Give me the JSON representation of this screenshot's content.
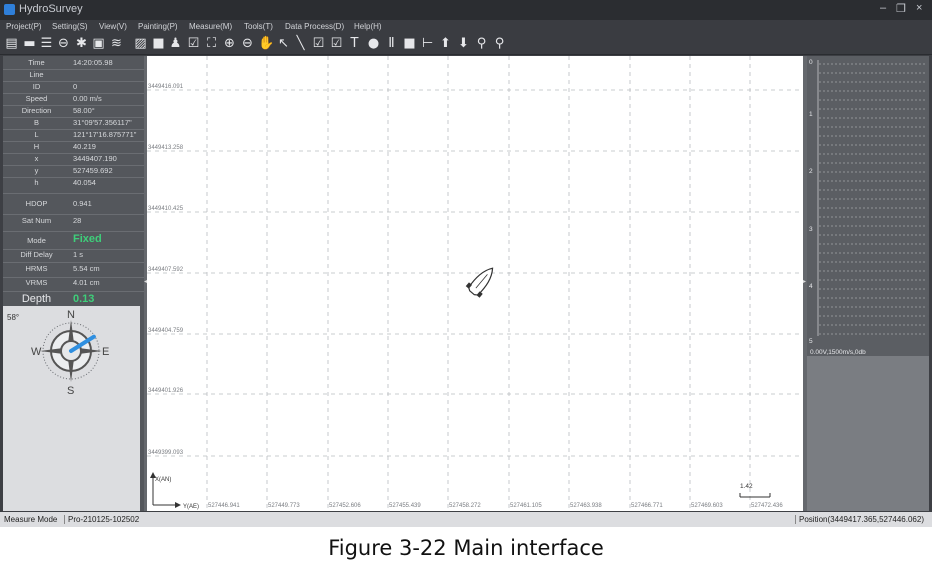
{
  "window": {
    "title": "HydroSurvey"
  },
  "menu": [
    "Project(P)",
    "Setting(S)",
    "View(V)",
    "Painting(P)",
    "Measure(M)",
    "Tools(T)",
    "Data Process(D)",
    "Help(H)"
  ],
  "toolbar_icons": [
    "new-project-icon",
    "open-icon",
    "database-icon",
    "link-icon",
    "settings-icon",
    "image-icon",
    "wave-icon",
    "edit-icon",
    "record-icon",
    "survey-icon",
    "checklist-icon",
    "fullscreen-icon",
    "zoom-in-icon",
    "zoom-out-icon",
    "pan-icon",
    "pointer-icon",
    "line-icon",
    "edit-note-icon",
    "edit-doc-icon",
    "text-icon",
    "start-record-icon",
    "pause-icon",
    "stop-icon",
    "range-icon",
    "up-icon",
    "down-icon",
    "point-icon",
    "point-alt-icon"
  ],
  "info_rows": [
    {
      "label": "Time",
      "value": "14:20:05.98"
    },
    {
      "label": "Line",
      "value": ""
    },
    {
      "label": "ID",
      "value": "0"
    },
    {
      "label": "Speed",
      "value": "0.00 m/s"
    },
    {
      "label": "Direction",
      "value": "58.00°"
    },
    {
      "label": "B",
      "value": "31°09'57.356117\""
    },
    {
      "label": "L",
      "value": "121°17'16.875771\""
    },
    {
      "label": "H",
      "value": "40.219"
    },
    {
      "label": "x",
      "value": "3449407.190"
    },
    {
      "label": "y",
      "value": "527459.692"
    },
    {
      "label": "h",
      "value": "40.054"
    },
    {
      "label": "HDOP",
      "value": "0.941"
    },
    {
      "label": "Sat Num",
      "value": "28"
    },
    {
      "label": "Mode",
      "value": "Fixed"
    },
    {
      "label": "Diff Delay",
      "value": "1 s"
    },
    {
      "label": "HRMS",
      "value": "5.54 cm"
    },
    {
      "label": "VRMS",
      "value": "4.01 cm"
    },
    {
      "label": "Depth",
      "value": "0.13"
    }
  ],
  "compass": {
    "heading": "58°",
    "north": "N",
    "south": "S",
    "east": "E",
    "west": "W",
    "needle_deg": 58
  },
  "map": {
    "y_ticks": [
      "3449416.091",
      "3449413.258",
      "3449410.425",
      "3449407.592",
      "3449404.759",
      "3449401.926",
      "3449399.093"
    ],
    "x_ticks": [
      "527446.941",
      "527449.773",
      "527452.606",
      "527455.439",
      "527458.272",
      "527461.105",
      "527463.938",
      "527466.771",
      "527469.603",
      "527472.436"
    ],
    "axis_x_label": "X(AN)",
    "axis_y_label": "Y(AE)",
    "scale_value": "1.42"
  },
  "depth_panel": {
    "ticks": [
      "0",
      "1",
      "2",
      "3",
      "4",
      "5"
    ],
    "info": "0.00V,1500m/s,0db"
  },
  "status": {
    "mode": "Measure Mode",
    "project": "Pro-210125-102502",
    "position": "Position(3449417.365,527446.062)"
  },
  "caption": "Figure 3-22 Main interface",
  "colors": {
    "accent_green": "#3ecf7a",
    "needle_blue": "#2f8fe0",
    "panel_dark": "#54575c"
  }
}
